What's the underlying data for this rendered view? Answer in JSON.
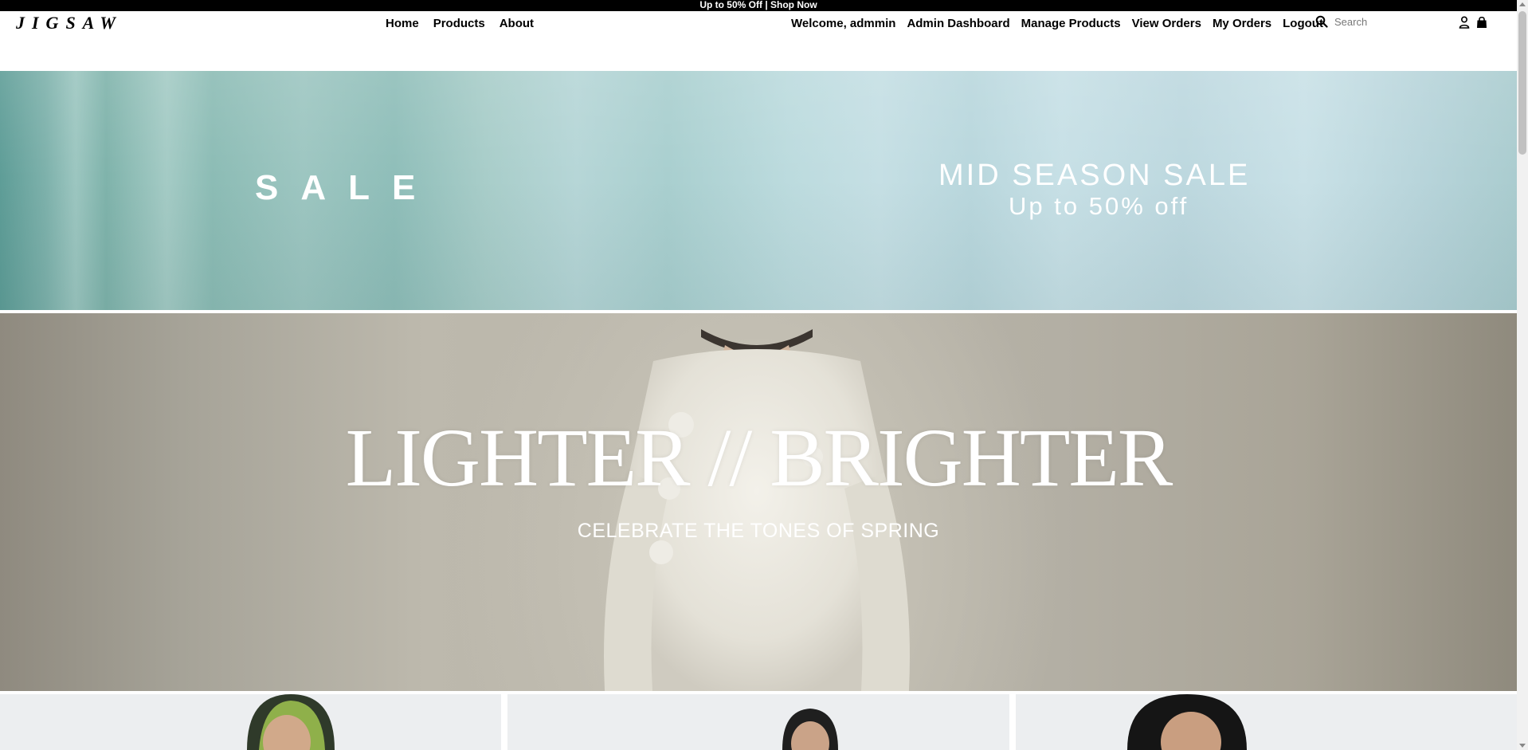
{
  "announcement": {
    "text": "Up to 50% Off | Shop Now"
  },
  "header": {
    "logo": "JIGSAW",
    "nav_left": [
      "Home",
      "Products",
      "About"
    ],
    "nav_right": [
      "Welcome, admmin",
      "Admin Dashboard",
      "Manage Products",
      "View Orders",
      "My Orders",
      "Logout"
    ],
    "search_placeholder": "Search",
    "icons": [
      "search-icon",
      "user-icon",
      "bag-icon"
    ]
  },
  "sale_banner": {
    "sale_word": "SALE",
    "title": "MID SEASON SALE",
    "subtitle": "Up to 50% off"
  },
  "hero": {
    "title": "LIGHTER // BRIGHTER",
    "subtitle": "CELEBRATE THE TONES OF SPRING"
  },
  "colors": {
    "announcement_bg": "#000000",
    "text": "#000000",
    "banner_teal": "#7fb3ab",
    "banner_light": "#c5dfe4",
    "hero_grey": "#b3afa4"
  }
}
